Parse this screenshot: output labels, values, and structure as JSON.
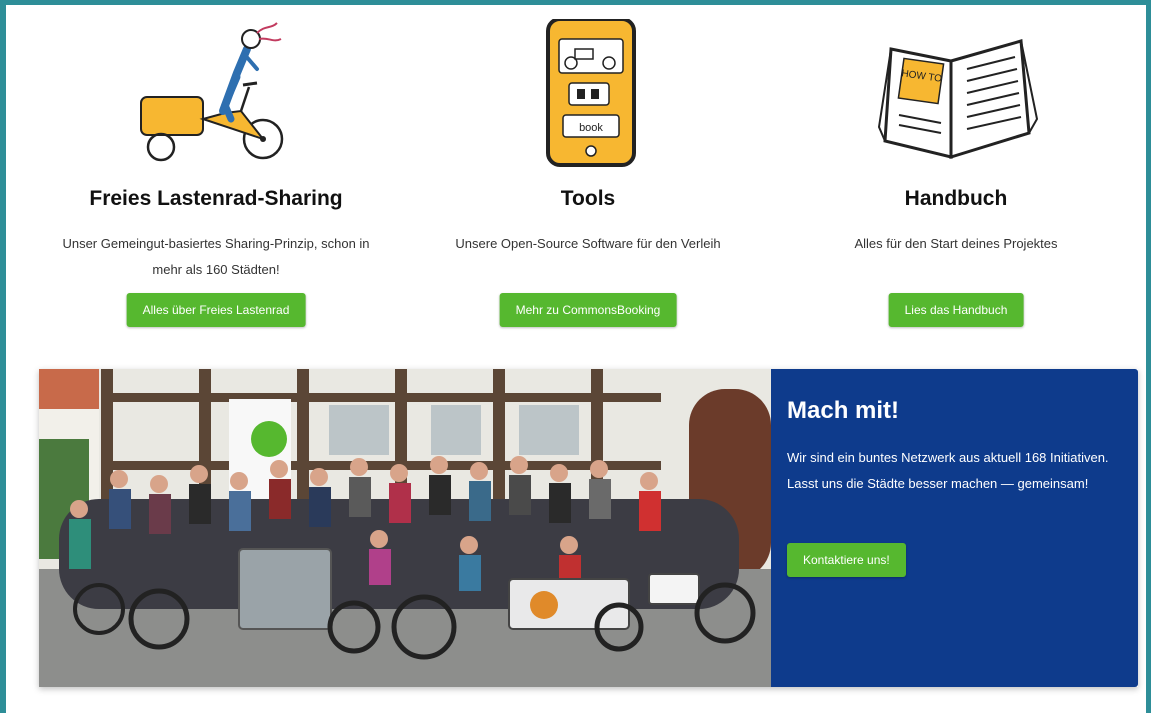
{
  "features": [
    {
      "icon": "cargo-bike-illustration",
      "title": "Freies Lastenrad-Sharing",
      "description": "Unser Gemeingut-basiertes Sharing-Prinzip, schon in mehr als 160 Städten!",
      "button_label": "Alles über Freies Lastenrad"
    },
    {
      "icon": "smartphone-tools-illustration",
      "title": "Tools",
      "description": "Unsere Open-Source Software für den Verleih",
      "button_label": "Mehr zu CommonsBooking"
    },
    {
      "icon": "open-book-illustration",
      "title": "Handbuch",
      "description": "Alles für den Start deines Projektes",
      "button_label": "Lies das Handbuch"
    }
  ],
  "illustration_text": {
    "book_page": "HOW TO",
    "phone_screen": "book"
  },
  "banner": {
    "photo": "group-photo-cargo-bikes",
    "title": "Mach mit!",
    "text": "Wir sind ein buntes Netzwerk aus aktuell 168 Initiativen. Lasst uns die Städte besser machen — gemeinsam!",
    "button_label": "Kontaktiere uns!"
  },
  "colors": {
    "accent_green": "#56b82f",
    "panel_blue": "#0e3b8c",
    "frame_teal": "#2e8e98",
    "illustration_yellow": "#f7b731"
  }
}
